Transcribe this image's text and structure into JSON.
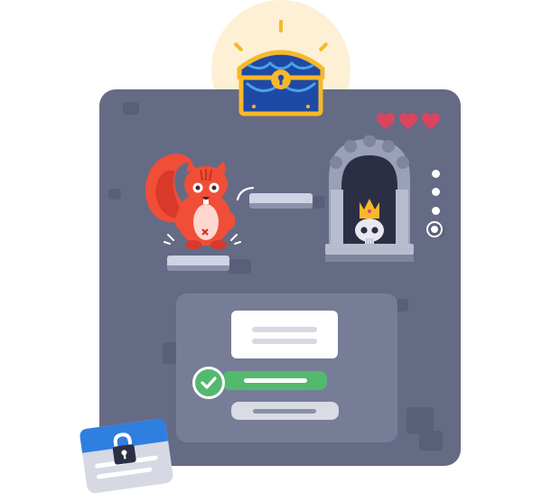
{
  "colors": {
    "panel": "#656a85",
    "brick": "#5a5f78",
    "quiz_card": "#777c97",
    "correct_answer": "#52b96e",
    "heart": "#d9455f",
    "squirrel": "#f04e37",
    "chest": "#1e4aa6",
    "gold": "#f7b82a",
    "lock_card_header": "#2f7fe0"
  },
  "hud": {
    "lives": 3,
    "lives_max": 3,
    "level_indicators": 4,
    "current_level": 4
  },
  "icons": {
    "treasure": "treasure-chest-icon",
    "heart": "heart-icon",
    "check": "check-icon",
    "lock": "lock-icon",
    "skull": "skull-icon",
    "crown": "crown-icon"
  }
}
